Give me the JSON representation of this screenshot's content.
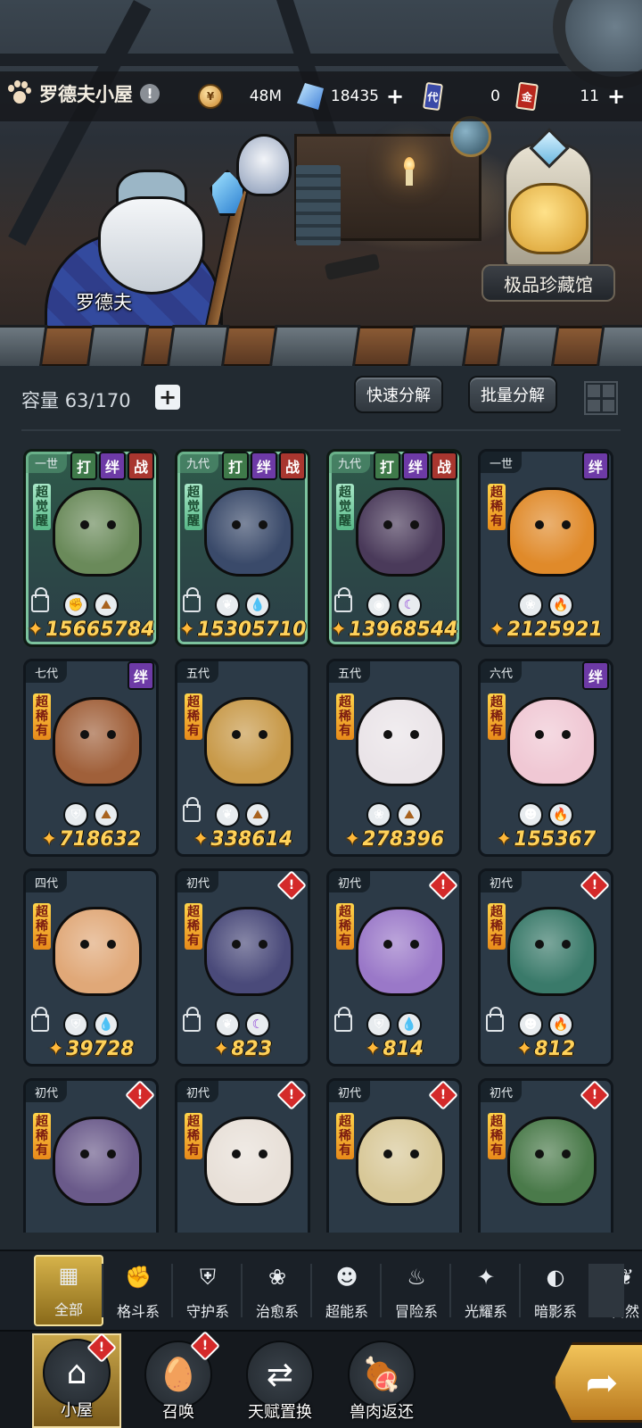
{
  "topbar": {
    "title": "罗德夫小屋",
    "alert": "!",
    "resources": [
      {
        "name": "gold-coin",
        "value": "48M",
        "icon": "coin-icon"
      },
      {
        "name": "crystal",
        "value": "18435",
        "icon": "crystal-icon",
        "addable": true
      },
      {
        "name": "generation-ticket",
        "value": "0",
        "icon": "ticket-icon",
        "ticket_char": "代"
      },
      {
        "name": "gold-ticket",
        "value": "11",
        "icon": "ticket-icon",
        "ticket_char": "金",
        "addable": true
      }
    ],
    "plus": "+"
  },
  "scene": {
    "npc_name": "罗德夫",
    "treasury_label": "极品珍藏馆"
  },
  "panel": {
    "capacity_label": "容量",
    "capacity_value": "63/170",
    "plus": "+",
    "quick_decompose": "快速分解",
    "batch_decompose": "批量分解"
  },
  "cards": [
    {
      "gen": "一世",
      "tags": [
        "打",
        "绊",
        "战"
      ],
      "rarity": "超觉醒",
      "rarity_style": "green",
      "frame": "green",
      "locked": true,
      "traits": [
        "fist",
        "earth"
      ],
      "power": "15665784",
      "color": "#6a8a5a"
    },
    {
      "gen": "九代",
      "tags": [
        "打",
        "绊",
        "战"
      ],
      "rarity": "超觉醒",
      "rarity_style": "green",
      "frame": "green",
      "locked": true,
      "traits": [
        "leaf",
        "water"
      ],
      "power": "15305710",
      "color": "#3a4a6a"
    },
    {
      "gen": "九代",
      "tags": [
        "打",
        "绊",
        "战"
      ],
      "rarity": "超觉醒",
      "rarity_style": "green",
      "frame": "green",
      "locked": true,
      "traits": [
        "eye",
        "moon"
      ],
      "power": "13968544",
      "color": "#4a3a5a"
    },
    {
      "gen": "一世",
      "tags": [
        "绊"
      ],
      "rarity": "超稀有",
      "rarity_style": "gold",
      "frame": "blue",
      "locked": false,
      "traits": [
        "sprout",
        "fire"
      ],
      "power": "2125921",
      "color": "#e08a2a"
    },
    {
      "gen": "七代",
      "tags": [
        "绊"
      ],
      "rarity": "超稀有",
      "rarity_style": "gold",
      "frame": "blue",
      "locked": false,
      "traits": [
        "shield",
        "earth"
      ],
      "power": "718632",
      "color": "#a0603a"
    },
    {
      "gen": "五代",
      "tags": [],
      "rarity": "超稀有",
      "rarity_style": "gold",
      "frame": "blue",
      "locked": true,
      "traits": [
        "leaf",
        "earth"
      ],
      "power": "338614",
      "color": "#c89a4a"
    },
    {
      "gen": "五代",
      "tags": [],
      "rarity": "超稀有",
      "rarity_style": "gold",
      "frame": "blue",
      "locked": false,
      "traits": [
        "sprout",
        "earth"
      ],
      "power": "278396",
      "color": "#eae4e8"
    },
    {
      "gen": "六代",
      "tags": [
        "绊"
      ],
      "rarity": "超稀有",
      "rarity_style": "gold",
      "frame": "blue",
      "locked": false,
      "traits": [
        "alien",
        "fire"
      ],
      "power": "155367",
      "color": "#f0c8d4"
    },
    {
      "gen": "四代",
      "tags": [],
      "rarity": "超稀有",
      "rarity_style": "gold",
      "frame": "blue",
      "locked": true,
      "traits": [
        "shield",
        "water"
      ],
      "power": "39728",
      "color": "#e0a878"
    },
    {
      "gen": "初代",
      "tags": [],
      "warn": "!",
      "rarity": "超稀有",
      "rarity_style": "gold",
      "frame": "blue",
      "locked": true,
      "traits": [
        "leaf",
        "moon"
      ],
      "power": "823",
      "color": "#4a4a7a"
    },
    {
      "gen": "初代",
      "tags": [],
      "warn": "!",
      "rarity": "超稀有",
      "rarity_style": "gold",
      "frame": "blue",
      "locked": true,
      "traits": [
        "shield",
        "water"
      ],
      "power": "814",
      "color": "#9a78c8"
    },
    {
      "gen": "初代",
      "tags": [],
      "warn": "!",
      "rarity": "超稀有",
      "rarity_style": "gold",
      "frame": "blue",
      "locked": true,
      "traits": [
        "alien",
        "fire"
      ],
      "power": "812",
      "color": "#3a7a6a"
    },
    {
      "gen": "初代",
      "tags": [],
      "warn": "!",
      "rarity": "超稀有",
      "rarity_style": "gold",
      "frame": "blue",
      "locked": false,
      "traits": [],
      "power": "",
      "color": "#6a5a8a"
    },
    {
      "gen": "初代",
      "tags": [],
      "warn": "!",
      "rarity": "超稀有",
      "rarity_style": "gold",
      "frame": "blue",
      "locked": false,
      "traits": [],
      "power": "",
      "color": "#e8e0d8"
    },
    {
      "gen": "初代",
      "tags": [],
      "warn": "!",
      "rarity": "超稀有",
      "rarity_style": "gold",
      "frame": "blue",
      "locked": false,
      "traits": [],
      "power": "",
      "color": "#d8c898"
    },
    {
      "gen": "初代",
      "tags": [],
      "warn": "!",
      "rarity": "超稀有",
      "rarity_style": "gold",
      "frame": "blue",
      "locked": false,
      "traits": [],
      "power": "",
      "color": "#4a7a4a"
    }
  ],
  "filters": [
    {
      "label": "全部",
      "icon": "blocks-icon",
      "active": true
    },
    {
      "label": "格斗系",
      "icon": "fist-icon"
    },
    {
      "label": "守护系",
      "icon": "shield-icon"
    },
    {
      "label": "治愈系",
      "icon": "sprout-icon"
    },
    {
      "label": "超能系",
      "icon": "alien-icon"
    },
    {
      "label": "冒险系",
      "icon": "flame-lantern-icon"
    },
    {
      "label": "光耀系",
      "icon": "star-cross-icon"
    },
    {
      "label": "暗影系",
      "icon": "eclipse-icon"
    },
    {
      "label": "自然",
      "icon": "leaf-icon"
    }
  ],
  "nav": [
    {
      "label": "小屋",
      "icon": "house-icon",
      "active": true,
      "badge": "!"
    },
    {
      "label": "召唤",
      "icon": "egg-icon",
      "badge": "!"
    },
    {
      "label": "天赋置换",
      "icon": "swap-icon"
    },
    {
      "label": "兽肉返还",
      "icon": "meat-icon"
    }
  ],
  "colors": {
    "accent_gold": "#ffd25a",
    "alert_red": "#d42a2a",
    "bond_purple": "#6d3aa6",
    "fight_green": "#3f7a4a",
    "war_red": "#a8362f"
  }
}
